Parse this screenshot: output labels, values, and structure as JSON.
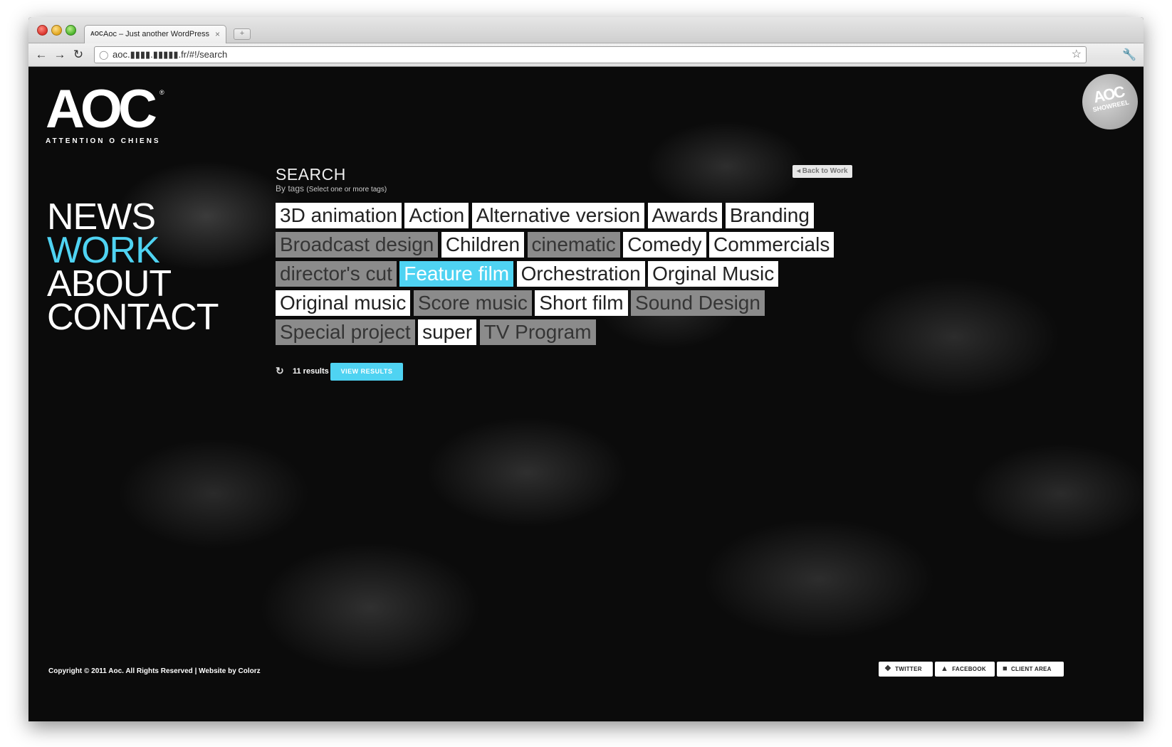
{
  "browser": {
    "tab_title": "Aoc – Just another WordPress",
    "tab_favicon": "AOC",
    "tab_close": "×",
    "new_tab": "+",
    "url": "aoc.▮▮▮▮.▮▮▮▮▮.fr/#!/search",
    "icons": [
      "back-icon",
      "forward-icon",
      "reload-icon",
      "globe-icon",
      "star-icon",
      "wrench-icon"
    ]
  },
  "logo": {
    "mark": "AOC",
    "reg": "®",
    "tagline": "ATTENTION O CHIENS"
  },
  "showreel": {
    "line1": "AOC",
    "line2": "SHOWREEL"
  },
  "nav": {
    "items": [
      {
        "label": "NEWS",
        "active": false
      },
      {
        "label": "WORK",
        "active": true
      },
      {
        "label": "ABOUT",
        "active": false
      },
      {
        "label": "CONTACT",
        "active": false
      }
    ],
    "active_color": "#4fd3f2"
  },
  "search": {
    "title": "SEARCH",
    "subtitle": "By tags",
    "hint": "(Select one or more tags)",
    "back_label": "◂ Back to Work"
  },
  "tags": [
    {
      "label": "3D animation",
      "state": "on"
    },
    {
      "label": "Action",
      "state": "on"
    },
    {
      "label": "Alternative version",
      "state": "on"
    },
    {
      "label": "Awards",
      "state": "on"
    },
    {
      "label": "Branding",
      "state": "on"
    },
    {
      "label": "Broadcast design",
      "state": "off"
    },
    {
      "label": "Children",
      "state": "on"
    },
    {
      "label": "cinematic",
      "state": "off"
    },
    {
      "label": "Comedy",
      "state": "on"
    },
    {
      "label": "Commercials",
      "state": "on"
    },
    {
      "label": "director's cut",
      "state": "off"
    },
    {
      "label": "Feature film",
      "state": "selected"
    },
    {
      "label": "Orchestration",
      "state": "on"
    },
    {
      "label": "Orginal Music",
      "state": "on"
    },
    {
      "label": "Original music",
      "state": "on"
    },
    {
      "label": "Score music",
      "state": "off"
    },
    {
      "label": "Short film",
      "state": "on"
    },
    {
      "label": "Sound Design",
      "state": "off"
    },
    {
      "label": "Special project",
      "state": "off"
    },
    {
      "label": "super",
      "state": "on"
    },
    {
      "label": "TV Program",
      "state": "off"
    }
  ],
  "results": {
    "count_label": "11 results",
    "view_button": "VIEW RESULTS"
  },
  "footer": {
    "copyright": "Copyright © 2011 Aoc. All Rights Reserved | Website by Colorz",
    "twitter": "TWITTER",
    "facebook": "FACEBOOK",
    "client_area": "CLIENT AREA"
  },
  "colors": {
    "accent": "#4fd3f2",
    "tag_on_bg": "#ffffff",
    "tag_off_bg": "#8b8b8b",
    "background": "#0b0b0b"
  }
}
